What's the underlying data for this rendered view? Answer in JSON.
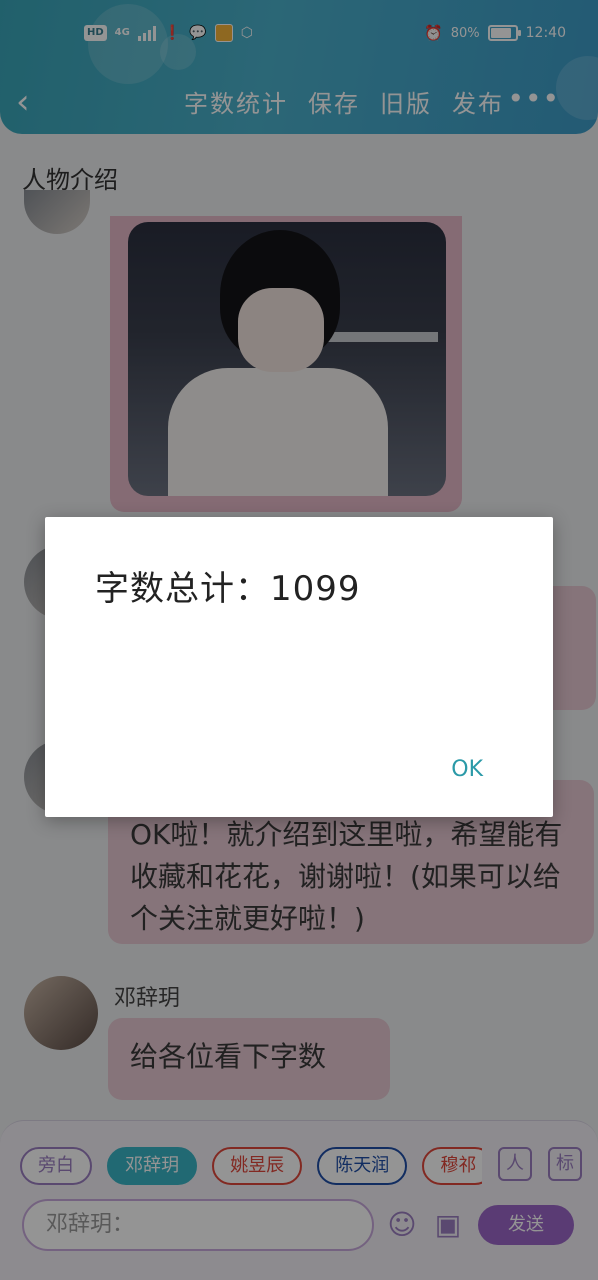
{
  "status_bar": {
    "hd_badge": "HD",
    "network": "4G",
    "battery_percent": "80%",
    "time": "12:40",
    "icons": [
      "hd-icon",
      "signal-icon",
      "alert-icon",
      "wechat-icon",
      "app-icon",
      "shield-icon",
      "alarm-icon",
      "battery-icon"
    ]
  },
  "nav": {
    "back_icon": "chevron-left-icon",
    "actions": [
      "字数统计",
      "保存",
      "旧版",
      "发布"
    ],
    "more_label": "•••"
  },
  "page": {
    "section_title": "人物介绍"
  },
  "messages": {
    "closing_text": "OK啦！就介绍到这里啦，希望能有收藏和花花，谢谢啦！(如果可以给个关注就更好啦！)",
    "last_sender": "邓辞玥",
    "last_text": "给各位看下字数"
  },
  "composer": {
    "chips": [
      {
        "label": "旁白",
        "color": "#9b7fc1",
        "active": false
      },
      {
        "label": "邓辞玥",
        "color": "#3ab5c6",
        "active": true
      },
      {
        "label": "姚昱辰",
        "color": "#e0483c",
        "active": false
      },
      {
        "label": "陈天润",
        "color": "#1f4fa8",
        "active": false
      },
      {
        "label": "穆祁",
        "color": "#e0483c",
        "active": false
      }
    ],
    "role_button": "人",
    "tag_button": "标",
    "input_placeholder": "邓辞玥：",
    "send_label": "发送"
  },
  "dialog": {
    "message": "字数总计：1099",
    "ok_label": "OK"
  },
  "colors": {
    "header": "#46adc6",
    "bubble": "#e7c8d3",
    "accent": "#9b66c8",
    "ok_text": "#2b9aa8"
  }
}
